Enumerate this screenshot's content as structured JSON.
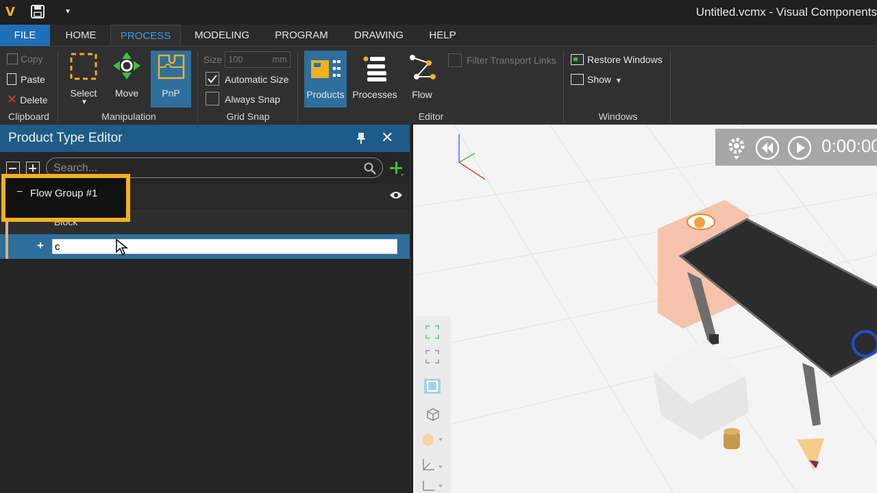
{
  "titlebar": {
    "logo": "V",
    "window_title": "Untitled.vcmx - Visual Components"
  },
  "tabs": [
    {
      "label": "FILE"
    },
    {
      "label": "HOME"
    },
    {
      "label": "PROCESS"
    },
    {
      "label": "MODELING"
    },
    {
      "label": "PROGRAM"
    },
    {
      "label": "DRAWING"
    },
    {
      "label": "HELP"
    }
  ],
  "ribbon": {
    "clipboard": {
      "copy": "Copy",
      "paste": "Paste",
      "delete": "Delete",
      "label": "Clipboard"
    },
    "manipulation": {
      "select": "Select",
      "move": "Move",
      "pnp": "PnP",
      "label": "Manipulation"
    },
    "grid_snap": {
      "size_label": "Size",
      "size_value": "100",
      "size_unit": "mm",
      "automatic_size": "Automatic Size",
      "always_snap": "Always Snap",
      "label": "Grid Snap"
    },
    "editor": {
      "products": "Products",
      "processes": "Processes",
      "flow": "Flow",
      "filter_transport_links": "Filter Transport Links",
      "label": "Editor"
    },
    "windows": {
      "restore_windows": "Restore Windows",
      "show": "Show",
      "label": "Windows"
    }
  },
  "panel": {
    "title": "Product Type Editor",
    "search_placeholder": "Search...",
    "flow_group": "Flow Group #1",
    "block": "Block",
    "edit_value": "c"
  },
  "viewport": {
    "time": "0:00:00"
  },
  "colors": {
    "accent_blue": "#1f6fb8",
    "panel_header": "#1d5c86",
    "highlight_yellow": "#f5b01b",
    "selected_row": "#2f6d9b"
  }
}
